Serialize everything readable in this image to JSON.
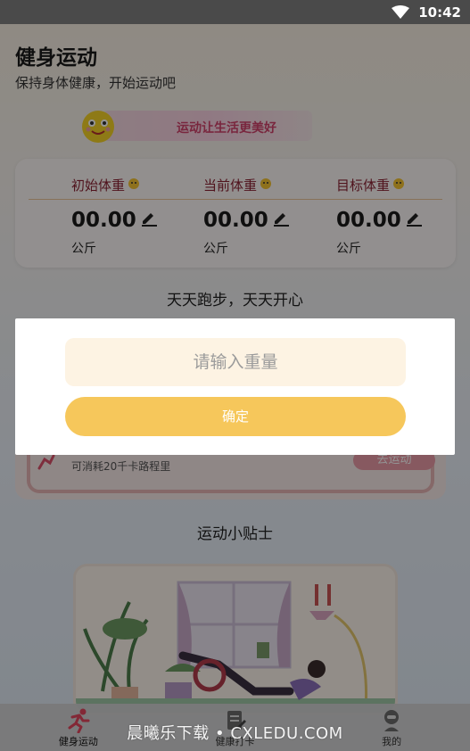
{
  "status_bar": {
    "time": "10:42",
    "wifi_icon": "wifi-icon"
  },
  "header": {
    "title": "健身运动",
    "subtitle": "保持身体健康，开始运动吧"
  },
  "banner": {
    "text": "运动让生活更美好",
    "mascot_icon": "smiley-mascot-icon"
  },
  "weights": [
    {
      "label": "初始体重",
      "value": "00.00",
      "unit": "公斤"
    },
    {
      "label": "当前体重",
      "value": "00.00",
      "unit": "公斤"
    },
    {
      "label": "目标体重",
      "value": "00.00",
      "unit": "公斤"
    }
  ],
  "slogan": "天天跑步，天天开心",
  "run_card": {
    "subtitle": "可消耗20千卡路程里",
    "button": "去运动"
  },
  "tips": {
    "title": "运动小贴士"
  },
  "dialog": {
    "placeholder": "请输入重量",
    "value": "",
    "confirm": "确定"
  },
  "tabbar": {
    "items": [
      {
        "label": "健身运动",
        "icon": "running-icon",
        "active": true
      },
      {
        "label": "健康打卡",
        "icon": "checkin-icon",
        "active": false
      },
      {
        "label": "我的",
        "icon": "profile-icon",
        "active": false
      }
    ]
  },
  "watermark": "晨曦乐下载 • CXLEDU.COM",
  "colors": {
    "accent": "#f6c75b",
    "label_red": "#8a2233",
    "overlay": "rgba(0,0,0,0.42)"
  }
}
